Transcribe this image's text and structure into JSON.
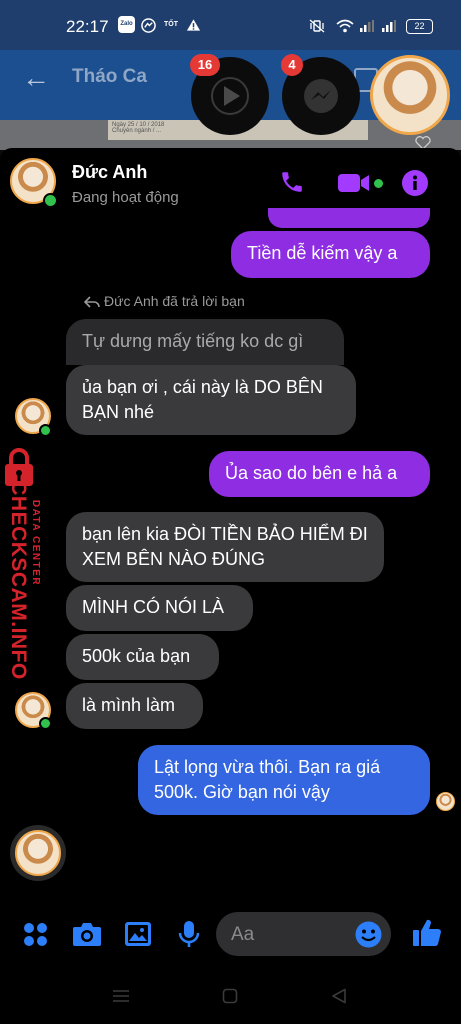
{
  "status_bar": {
    "time": "22:17",
    "left_icons": [
      "zalo-icon",
      "messenger-icon",
      "tot-icon",
      "warning-icon"
    ],
    "tot_label": "TỐT",
    "zalo_label": "Zalo",
    "battery": "22"
  },
  "background_app": {
    "title": "Tháo Ca",
    "doc_lines": [
      "Ngày 25 / 10 / 2018",
      "Chuyên ngành / ...",
      "P.13 - Bình Thạnh, TP.HCM"
    ]
  },
  "chat_heads": [
    {
      "name": "video-chat-head",
      "badge": "16"
    },
    {
      "name": "messenger-chat-head",
      "badge": "4"
    }
  ],
  "conversation": {
    "contact_name": "Đức Anh",
    "status": "Đang hoạt động",
    "reply_note": "Đức Anh đã trả lời bạn",
    "messages": [
      {
        "from": "me",
        "text": "Tiền dễ kiếm vậy a"
      },
      {
        "from": "them",
        "text": "Tự dưng mấy tiếng ko dc gì"
      },
      {
        "from": "them",
        "text": "ủa bạn ơi , cái này là DO BÊN BẠN nhé"
      },
      {
        "from": "me",
        "text": "Ủa sao do bên e hả a"
      },
      {
        "from": "them",
        "text": "bạn lên kia ĐÒI TIỀN BẢO HIỂM ĐI XEM BÊN NÀO ĐÚNG"
      },
      {
        "from": "them",
        "text": "MÌNH CÓ NÓI LÀ"
      },
      {
        "from": "them",
        "text": "500k của bạn"
      },
      {
        "from": "them",
        "text": "là mình làm"
      },
      {
        "from": "me",
        "text": "Lật lọng vừa thôi. Bạn ra giá 500k. Giờ bạn nói vậy"
      }
    ]
  },
  "watermark": {
    "brand": "CHECKSCAM.INFO",
    "tag": "DATA CENTER"
  },
  "composer": {
    "placeholder": "Aa"
  },
  "colors": {
    "accent": "#a23bff",
    "out_purple": "#8e2de2",
    "out_blue": "#3366e0",
    "incoming": "#3a3a3c",
    "online": "#31c24d",
    "composer_icon": "#2d7ff9"
  }
}
